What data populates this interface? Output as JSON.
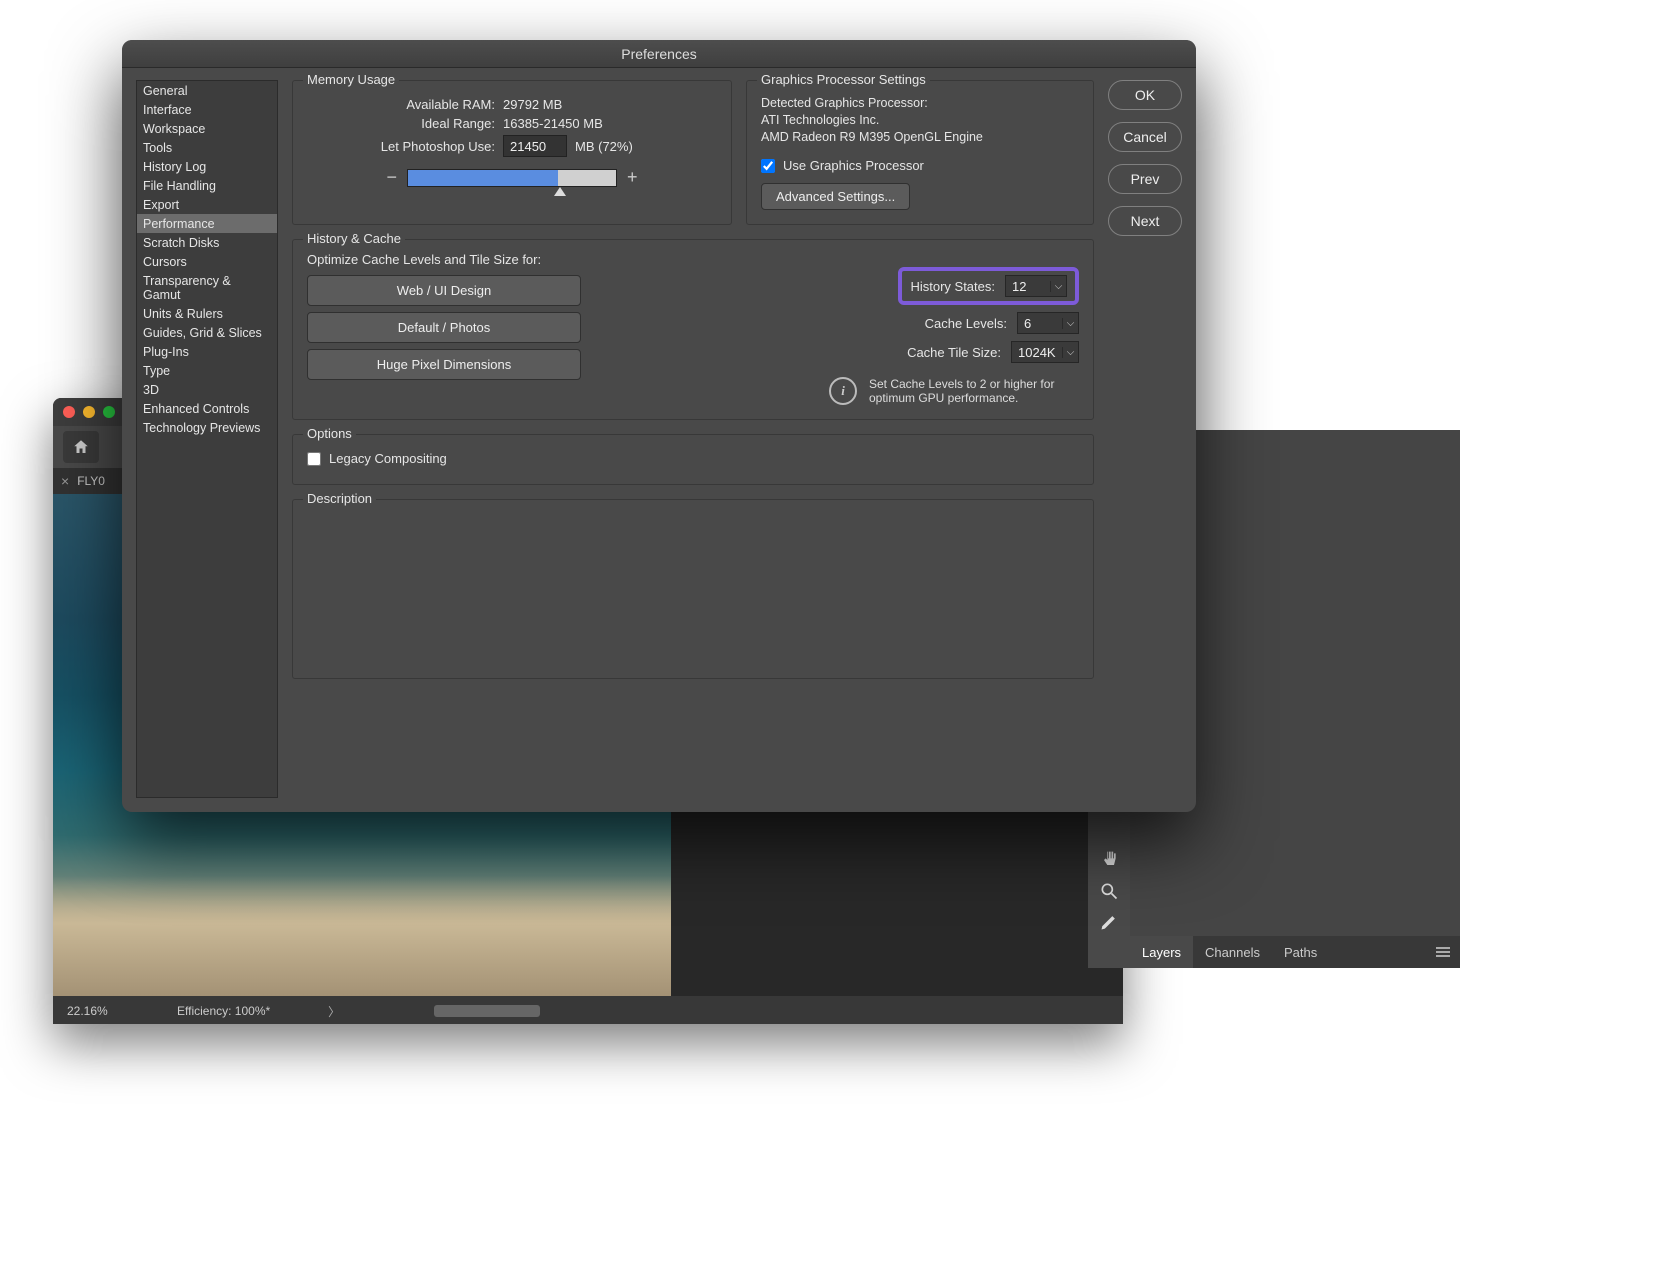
{
  "dialog": {
    "title": "Preferences",
    "sidebar": [
      "General",
      "Interface",
      "Workspace",
      "Tools",
      "History Log",
      "File Handling",
      "Export",
      "Performance",
      "Scratch Disks",
      "Cursors",
      "Transparency & Gamut",
      "Units & Rulers",
      "Guides, Grid & Slices",
      "Plug-Ins",
      "Type",
      "3D",
      "Enhanced Controls",
      "Technology Previews"
    ],
    "sidebar_selected": "Performance",
    "buttons": {
      "ok": "OK",
      "cancel": "Cancel",
      "prev": "Prev",
      "next": "Next"
    }
  },
  "memory": {
    "title": "Memory Usage",
    "available_label": "Available RAM:",
    "available_value": "29792 MB",
    "ideal_label": "Ideal Range:",
    "ideal_value": "16385-21450 MB",
    "let_label": "Let Photoshop Use:",
    "let_value": "21450",
    "let_suffix": "MB (72%)",
    "slider_percent": 72
  },
  "gpu": {
    "title": "Graphics Processor Settings",
    "detected_label": "Detected Graphics Processor:",
    "vendor": "ATI Technologies Inc.",
    "model": "AMD Radeon R9 M395 OpenGL Engine",
    "use_label": "Use Graphics Processor",
    "use_checked": true,
    "adv_btn": "Advanced Settings..."
  },
  "history": {
    "title": "History & Cache",
    "optimize_label": "Optimize Cache Levels and Tile Size for:",
    "presets": [
      "Web / UI Design",
      "Default / Photos",
      "Huge Pixel Dimensions"
    ],
    "states_label": "History States:",
    "states_value": "12",
    "levels_label": "Cache Levels:",
    "levels_value": "6",
    "tile_label": "Cache Tile Size:",
    "tile_value": "1024K",
    "info": "Set Cache Levels to 2 or higher for optimum GPU performance."
  },
  "options": {
    "title": "Options",
    "legacy_label": "Legacy Compositing",
    "legacy_checked": false
  },
  "description": {
    "title": "Description"
  },
  "bg": {
    "tab": "FLY0",
    "zoom": "22.16%",
    "efficiency": "Efficiency: 100%*",
    "panel_tabs": [
      "Layers",
      "Channels",
      "Paths"
    ]
  }
}
